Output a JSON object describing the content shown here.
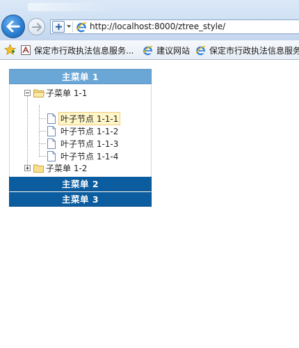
{
  "browser": {
    "url": "http://localhost:8000/ztree_style/",
    "favorites": [
      {
        "label": "保定市行政执法信息服务...",
        "icon": "site-favicon"
      },
      {
        "label": "建议网站",
        "icon": "ie-icon"
      },
      {
        "label": "保定市行政执法信息服务",
        "icon": "ie-icon"
      }
    ]
  },
  "menu": {
    "main1": "主菜单 1",
    "main2": "主菜单 2",
    "main3": "主菜单 3",
    "tree": {
      "sub1": "子菜单 1-1",
      "leaves": [
        "叶子节点 1-1-1",
        "叶子节点 1-1-2",
        "叶子节点 1-1-3",
        "叶子节点 1-1-4"
      ],
      "sub2": "子菜单 1-2",
      "selected": "叶子节点 1-1-1"
    }
  },
  "colors": {
    "active_header": "#6aa6d6",
    "closed_header": "#0c5d9f",
    "selected_bg": "#fff6c8"
  }
}
